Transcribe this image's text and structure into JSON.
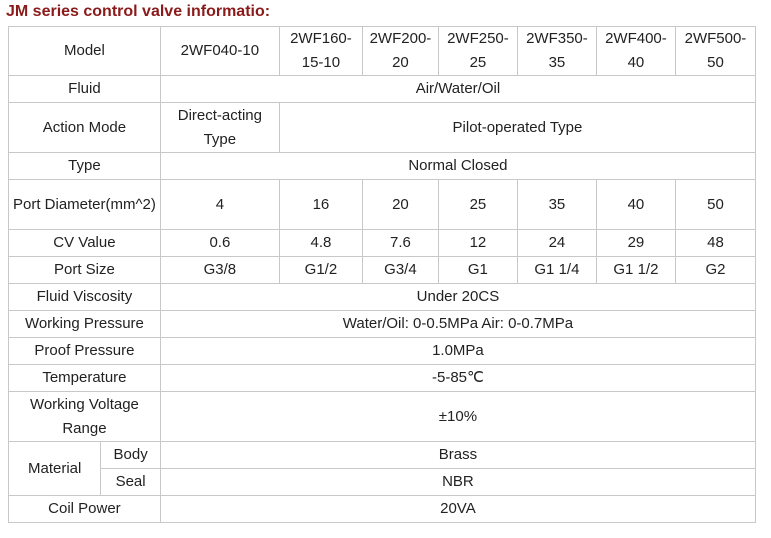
{
  "title": "JM series control valve informatio:",
  "table": {
    "model_label": "Model",
    "models": [
      "2WF040-10",
      "2WF160-15-10",
      "2WF200-20",
      "2WF250-25",
      "2WF350-35",
      "2WF400-40",
      "2WF500-50"
    ],
    "fluid_label": "Fluid",
    "fluid_value": "Air/Water/Oil",
    "action_label": "Action Mode",
    "action_direct": "Direct-acting Type",
    "action_pilot": "Pilot-operated Type",
    "type_label": "Type",
    "type_value": "Normal Closed",
    "port_diameter_label": "Port Diameter(mm^2)",
    "port_diameters": [
      "4",
      "16",
      "20",
      "25",
      "35",
      "40",
      "50"
    ],
    "cv_label": "CV Value",
    "cv_values": [
      "0.6",
      "4.8",
      "7.6",
      "12",
      "24",
      "29",
      "48"
    ],
    "port_size_label": "Port Size",
    "port_sizes": [
      "G3/8",
      "G1/2",
      "G3/4",
      "G1",
      "G1 1/4",
      "G1 1/2",
      "G2"
    ],
    "viscosity_label": "Fluid Viscosity",
    "viscosity_value": "Under 20CS",
    "working_pressure_label": "Working Pressure",
    "working_pressure_value": "Water/Oil: 0-0.5MPa Air: 0-0.7MPa",
    "proof_pressure_label": "Proof Pressure",
    "proof_pressure_value": "1.0MPa",
    "temperature_label": "Temperature",
    "temperature_value": "-5-85℃",
    "voltage_label": "Working Voltage Range",
    "voltage_value": "±10%",
    "material_label": "Material",
    "body_label": "Body",
    "body_value": "Brass",
    "seal_label": "Seal",
    "seal_value": "NBR",
    "coil_label": "Coil Power",
    "coil_value": "20VA"
  }
}
